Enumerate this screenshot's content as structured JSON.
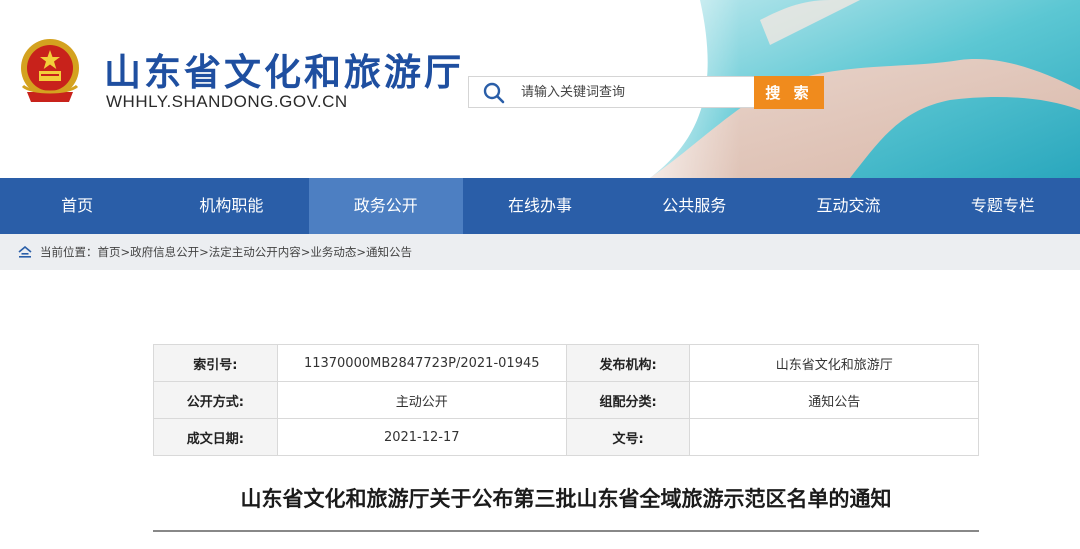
{
  "header": {
    "site_name": "山东省文化和旅游厅",
    "site_domain": "WHHLY.SHANDONG.GOV.CN",
    "emblem_icon": "national-emblem-icon"
  },
  "search": {
    "placeholder": "请输入关键词查询",
    "button_label": "搜 索",
    "button_color": "#f08b1d"
  },
  "nav": {
    "color": "#2a5ea8",
    "active_color": "#4d7fc2",
    "items": [
      {
        "label": "首页"
      },
      {
        "label": "机构职能"
      },
      {
        "label": "政务公开",
        "active": true
      },
      {
        "label": "在线办事"
      },
      {
        "label": "公共服务"
      },
      {
        "label": "互动交流"
      },
      {
        "label": "专题专栏"
      }
    ]
  },
  "breadcrumb": {
    "text": "当前位置：首页>政府信息公开>法定主动公开内容>业务动态>通知公告"
  },
  "meta": {
    "index_label": "索引号:",
    "index_value": "11370000MB2847723P/2021-01945",
    "publisher_label": "发布机构:",
    "publisher_value": "山东省文化和旅游厅",
    "disclosure_label": "公开方式:",
    "disclosure_value": "主动公开",
    "category_label": "组配分类:",
    "category_value": "通知公告",
    "date_label": "成文日期:",
    "date_value": "2021-12-17",
    "docno_label": "文号:",
    "docno_value": ""
  },
  "article": {
    "title": "山东省文化和旅游厅关于公布第三批山东省全域旅游示范区名单的通知"
  }
}
